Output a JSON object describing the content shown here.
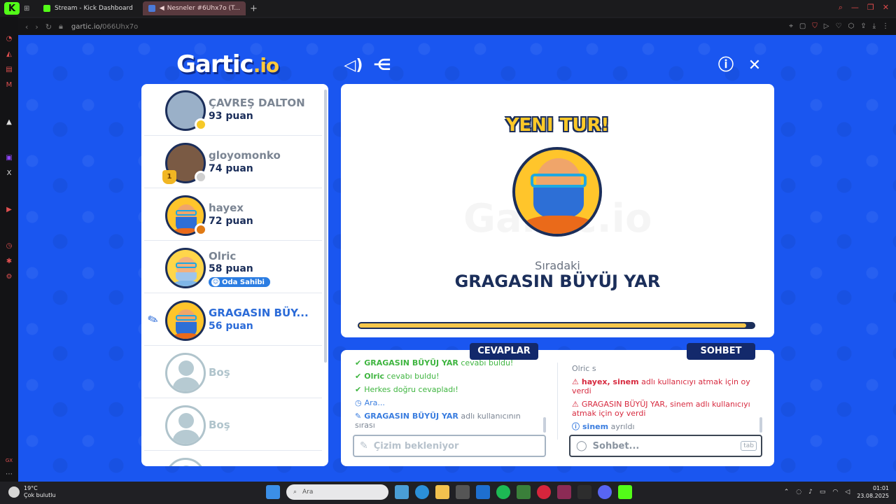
{
  "browser": {
    "tabs": [
      {
        "label": "Stream - Kick Dashboard",
        "active": false,
        "color": "#53fc18"
      },
      {
        "label": "Nesneler #6Uhx7o (T...",
        "active": true,
        "color": "#e25252"
      }
    ],
    "url": "gartic.io/",
    "url_path": "066Uhx7o"
  },
  "game": {
    "logo_main": "Gartic",
    "logo_suffix": ".io",
    "players": [
      {
        "name": "ÇAVREŞ DALTON",
        "points": "93 puan",
        "status_color": "#f6c928"
      },
      {
        "name": "gloyomonko",
        "points": "74 puan",
        "status_color": "#cfcfcf",
        "trophy": "1"
      },
      {
        "name": "hayex",
        "points": "72 puan",
        "status_color": "#e07a14"
      },
      {
        "name": "Olric",
        "points": "58 puan",
        "badge": "Oda Sahibi"
      },
      {
        "name": "GRAGASIN BÜY...",
        "points": "56 puan"
      },
      {
        "name": "Boş"
      },
      {
        "name": "Boş"
      }
    ],
    "stage": {
      "title": "YENI TUR!",
      "watermark": "Gartic.io",
      "next_label": "Sıradaki",
      "next_player": "GRAGASIN BÜYÜJ YAR",
      "progress": 0.98
    },
    "answers_tab": "CEVAPLAR",
    "chat_tab": "SOHBET",
    "answers": [
      {
        "bold": "GRAGASIN BÜYÜJ YAR",
        "text": " cevabı buldu!",
        "type": "green",
        "icon": "✔"
      },
      {
        "bold": "Olric",
        "text": " cevabı buldu!",
        "type": "green",
        "icon": "✔"
      },
      {
        "bold": "",
        "text": "Herkes doğru cevapladı!",
        "type": "green",
        "icon": "✔"
      },
      {
        "bold": "",
        "text": "Ara...",
        "type": "blue",
        "icon": "◷"
      },
      {
        "bold": "GRAGASIN BÜYÜJ YAR",
        "text": " adlı kullanıcının sırası",
        "type": "blue",
        "icon": "✎"
      }
    ],
    "chat": [
      {
        "text": "Olric s",
        "type": "gray",
        "icon": ""
      },
      {
        "text": "hayex, sinem adlı kullanıcıyı atmak için oy verdi",
        "bold": "hayex, sinem",
        "rest": " adlı kullanıcıyı atmak için oy verdi",
        "type": "red",
        "icon": "⚠"
      },
      {
        "text": "GRAGASIN BÜYÜJ YAR, sinem adlı kullanıcıyı atmak için oy verdi",
        "bold": "GRAGASIN BÜYÜJ YAR, sinem",
        "rest": " adlı kullanıcıyı atmak için oy verdi",
        "type": "red",
        "icon": "⚠"
      },
      {
        "text": "sinem ayrıldı",
        "bold": "sinem",
        "rest": " ayrıldı",
        "type": "blue",
        "icon": "ⓘ"
      }
    ],
    "answer_input_placeholder": "Çizim bekleniyor",
    "chat_input_placeholder": "Sohbet...",
    "chat_input_key": "tab"
  },
  "taskbar": {
    "temperature": "19°C",
    "weather": "Çok bulutlu",
    "search_placeholder": "Ara",
    "time": "01:01",
    "date": "23.08.2025"
  }
}
